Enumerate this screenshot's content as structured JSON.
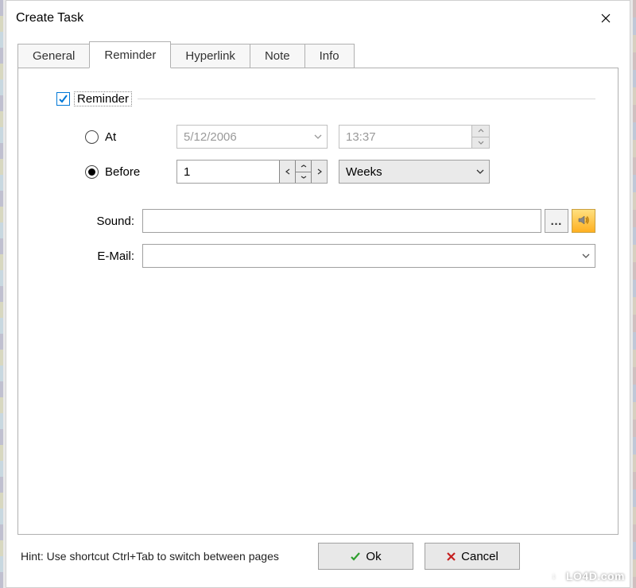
{
  "window": {
    "title": "Create Task"
  },
  "tabs": [
    {
      "label": "General"
    },
    {
      "label": "Reminder"
    },
    {
      "label": "Hyperlink"
    },
    {
      "label": "Note"
    },
    {
      "label": "Info"
    }
  ],
  "reminder": {
    "checkbox_label": "Reminder",
    "at": {
      "label": "At",
      "date": "5/12/2006",
      "time": "13:37"
    },
    "before": {
      "label": "Before",
      "value": "1",
      "unit": "Weeks"
    },
    "sound_label": "Sound:",
    "sound_value": "",
    "email_label": "E-Mail:",
    "email_value": ""
  },
  "footer": {
    "hint": "Hint: Use shortcut Ctrl+Tab to switch between pages",
    "ok_label": "Ok",
    "cancel_label": "Cancel"
  },
  "watermark": "LO4D.com"
}
